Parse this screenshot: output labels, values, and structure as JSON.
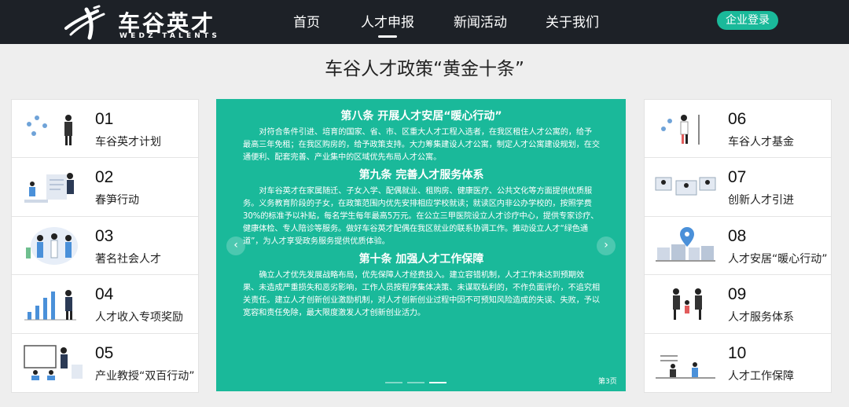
{
  "header": {
    "logo_cn": "车谷英才",
    "logo_en": "WEDZ TALENTS",
    "nav": [
      "首页",
      "人才申报",
      "新闻活动",
      "关于我们"
    ],
    "active_nav": "人才申报",
    "login": "企业登录"
  },
  "page_title": "车谷人才政策“黄金十条”",
  "left_cards": [
    {
      "num": "01",
      "label": "车谷英才计划"
    },
    {
      "num": "02",
      "label": "春笋行动"
    },
    {
      "num": "03",
      "label": "著名社会人才"
    },
    {
      "num": "04",
      "label": "人才收入专项奖励"
    },
    {
      "num": "05",
      "label": "产业教授“双百行动”"
    }
  ],
  "right_cards": [
    {
      "num": "06",
      "label": "车谷人才基金"
    },
    {
      "num": "07",
      "label": "创新人才引进"
    },
    {
      "num": "08",
      "label": "人才安居“暖心行动”"
    },
    {
      "num": "09",
      "label": "人才服务体系"
    },
    {
      "num": "10",
      "label": "人才工作保障"
    }
  ],
  "slide": {
    "sections": [
      {
        "title": "第八条 开展人才安居“暖心行动”",
        "text": "对符合条件引进、培育的国家、省、市、区重大人才工程入选者，在我区租住人才公寓的，给予最高三年免租；在我区购房的，给予政策支持。大力筹集建设人才公寓，制定人才公寓建设规划，在交通便利、配套完善、产业集中的区域优先布局人才公寓。"
      },
      {
        "title": "第九条 完善人才服务体系",
        "text": "对车谷英才在家属随迁、子女入学、配偶就业、租购房、健康医疗、公共文化等方面提供优质服务。义务教育阶段的子女，在政策范围内优先安排相应学校就读；就读区内非公办学校的，按照学费30%的标准予以补贴，每名学生每年最高5万元。在公立三甲医院设立人才诊疗中心，提供专家诊疗、健康体检、专人陪诊等服务。做好车谷英才配偶在我区就业的联系协调工作。推动设立人才“绿色通道”，为人才享受政务服务提供优质体验。"
      },
      {
        "title": "第十条 加强人才工作保障",
        "text": "确立人才优先发展战略布局，优先保障人才经费投入。建立容错机制，人才工作未达到预期效果、未造成严重损失和恶劣影响，工作人员按程序集体决策、未谋取私利的，不作负面评价，不追究相关责任。建立人才创新创业激励机制，对人才创新创业过程中因不可预知风险造成的失误、失败，予以宽容和责任免除，最大限度激发人才创新创业活力。"
      }
    ],
    "page_label": "第3页",
    "current_slide": 3,
    "total_slides": 3
  },
  "colors": {
    "header_bg": "#1d2127",
    "accent": "#1ab99a",
    "panel_bg": "#1ab99a"
  }
}
